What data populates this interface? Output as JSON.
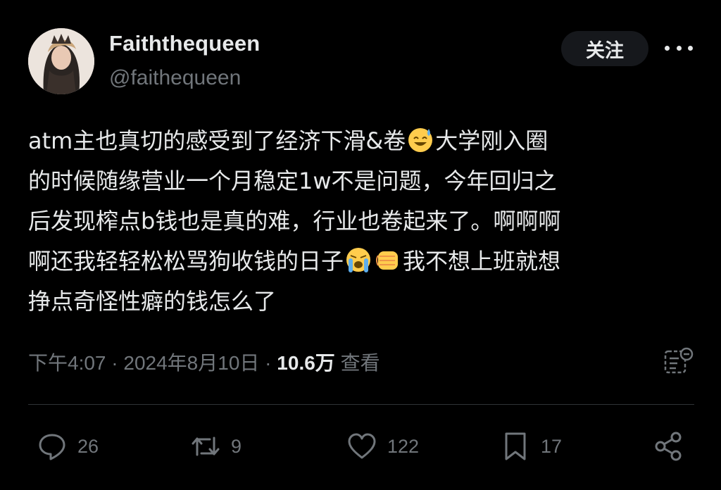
{
  "author": {
    "display_name": "Faiththequeen",
    "handle": "@faithequeen"
  },
  "follow_label": "关注",
  "tweet": {
    "segment_1": "atm主也真切的感受到了经济下滑&卷",
    "segment_2": "大学刚入圈\n的时候随缘营业一个月稳定1w不是问题，今年回归之\n后发现榨点b钱也是真的难，行业也卷起来了。啊啊啊\n啊还我轻轻松松骂狗收钱的日子",
    "segment_3": "我不想上班就想\n挣点奇怪性癖的钱怎么了",
    "emojis": [
      "sweat-smile-emoji",
      "loudly-crying-emoji",
      "oncoming-fist-emoji"
    ]
  },
  "meta": {
    "time": "下午4:07",
    "separator": " · ",
    "date": "2024年8月10日",
    "views_count": "10.6万",
    "views_label": " 查看"
  },
  "actions": {
    "replies": "26",
    "reposts": "9",
    "likes": "122",
    "bookmarks": "17"
  },
  "icons": [
    "more-icon",
    "analytics-icon",
    "reply-icon",
    "repost-icon",
    "like-icon",
    "bookmark-icon",
    "share-icon"
  ],
  "colors": {
    "background": "#000000",
    "text": "#e7e9ea",
    "secondary": "#71767b",
    "follow_bg": "#16181c"
  }
}
